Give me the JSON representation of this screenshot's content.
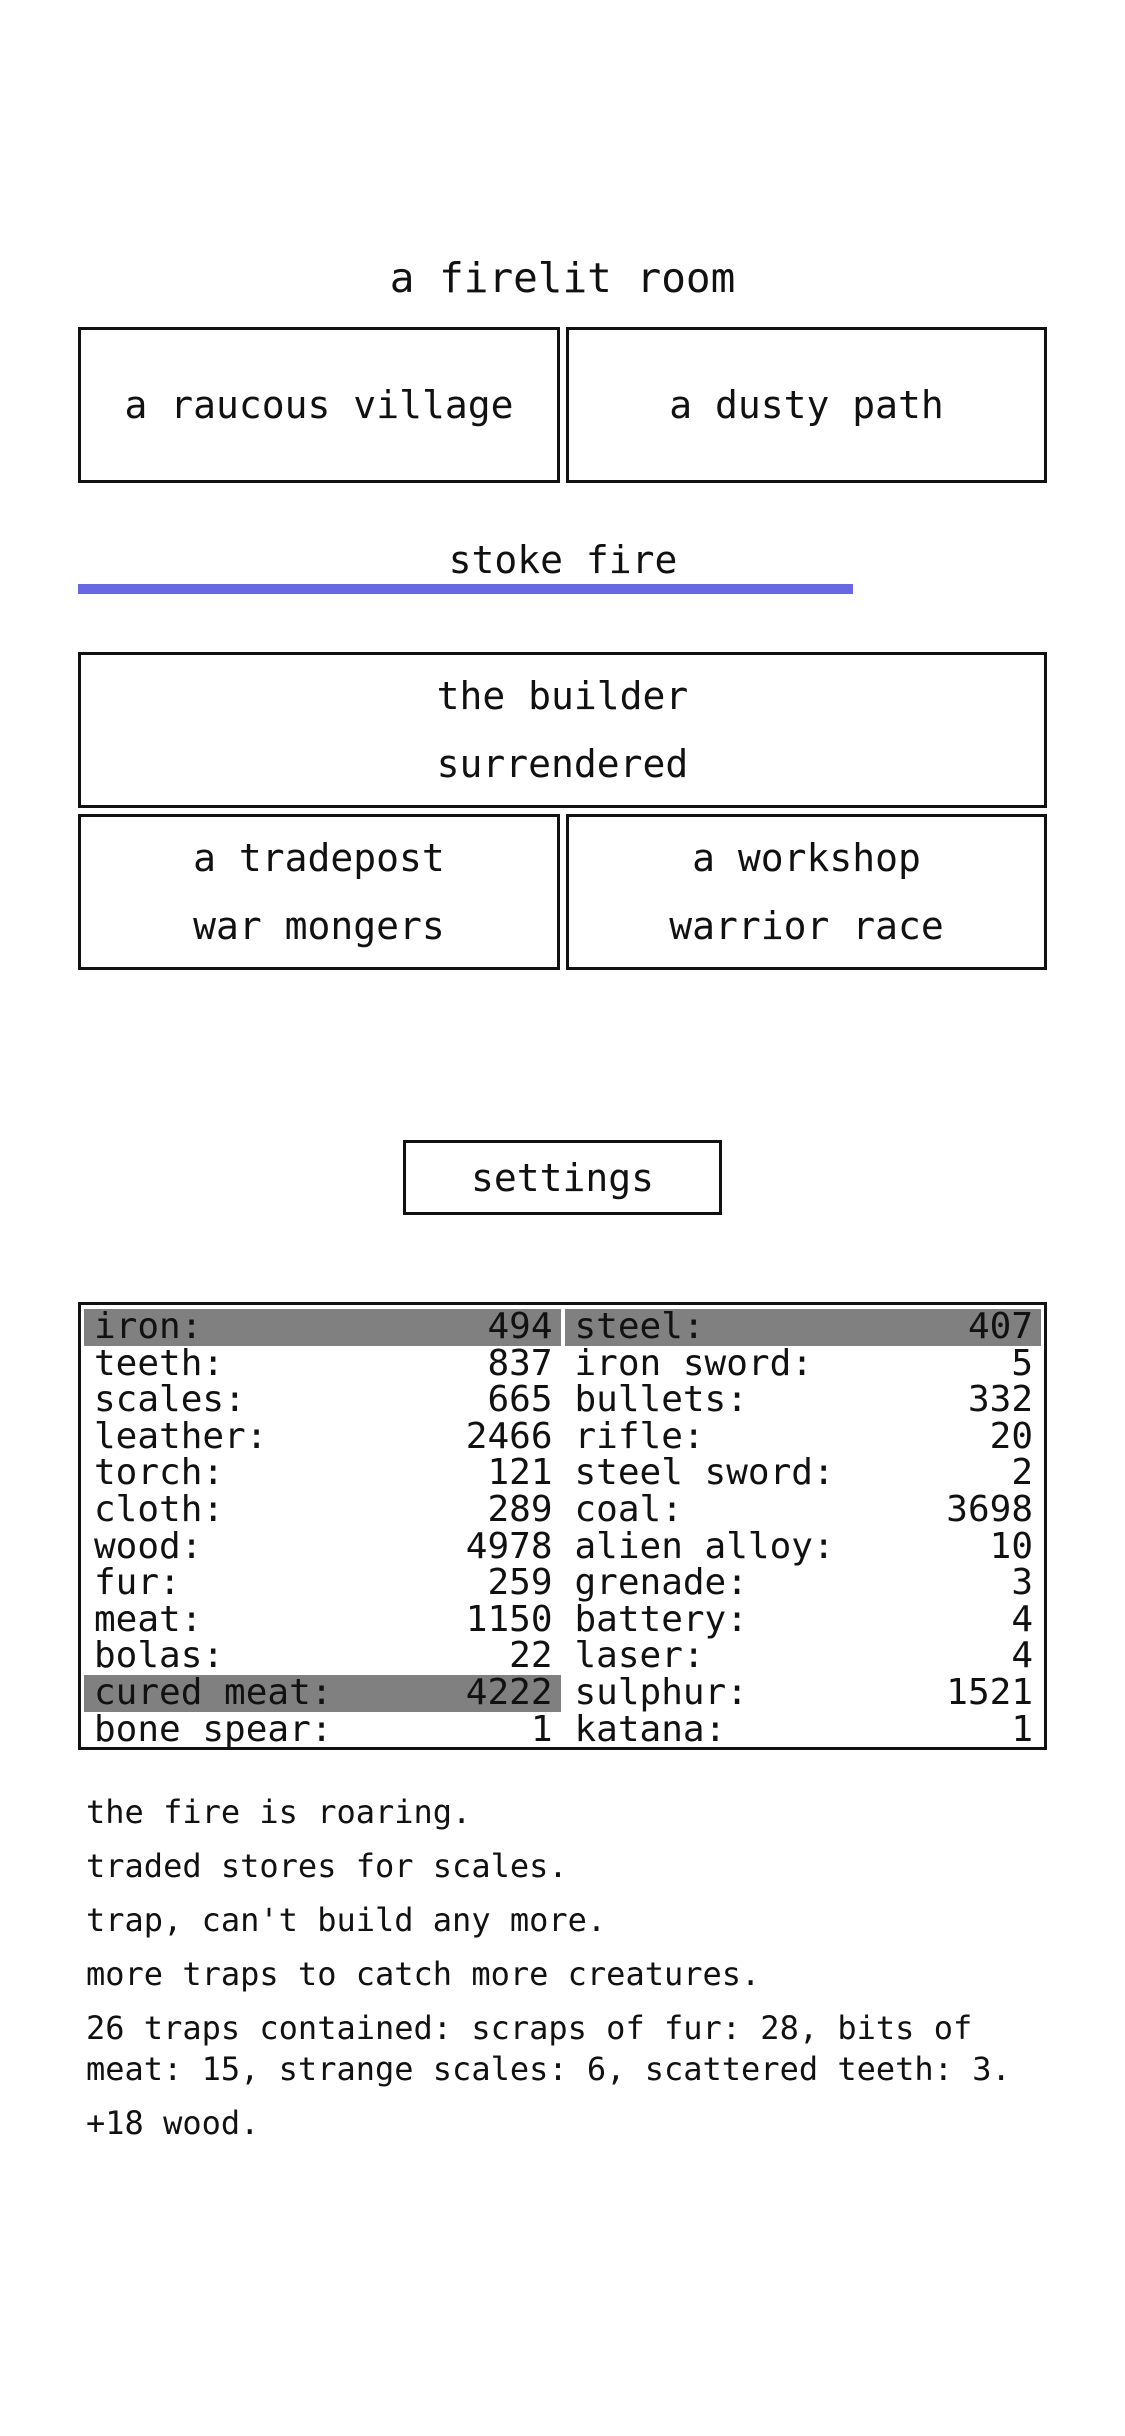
{
  "header": {
    "title": "a firelit room"
  },
  "nav": {
    "village": "a raucous village",
    "path": "a dusty path"
  },
  "actions": {
    "stoke": {
      "label": "stoke fire",
      "cooldown_fraction": 0.8
    }
  },
  "buildings": {
    "builder": [
      "the builder",
      "surrendered"
    ],
    "tradepost": [
      "a tradepost",
      "war mongers"
    ],
    "workshop": [
      "a workshop",
      "warrior race"
    ]
  },
  "settings_label": "settings",
  "stores": {
    "left": [
      {
        "name": "iron:",
        "value": "494",
        "highlight": true
      },
      {
        "name": "teeth:",
        "value": "837"
      },
      {
        "name": "scales:",
        "value": "665"
      },
      {
        "name": "leather:",
        "value": "2466"
      },
      {
        "name": "torch:",
        "value": "121"
      },
      {
        "name": "cloth:",
        "value": "289"
      },
      {
        "name": "wood:",
        "value": "4978"
      },
      {
        "name": "fur:",
        "value": "259"
      },
      {
        "name": "meat:",
        "value": "1150"
      },
      {
        "name": "bolas:",
        "value": "22"
      },
      {
        "name": "cured meat:",
        "value": "4222",
        "highlight": true
      },
      {
        "name": "bone spear:",
        "value": "1"
      }
    ],
    "right": [
      {
        "name": "steel:",
        "value": "407",
        "highlight": true
      },
      {
        "name": "iron sword:",
        "value": "5"
      },
      {
        "name": "bullets:",
        "value": "332"
      },
      {
        "name": "rifle:",
        "value": "20"
      },
      {
        "name": "steel sword:",
        "value": "2"
      },
      {
        "name": "coal:",
        "value": "3698"
      },
      {
        "name": "alien alloy:",
        "value": "10"
      },
      {
        "name": "grenade:",
        "value": "3"
      },
      {
        "name": "battery:",
        "value": "4"
      },
      {
        "name": "laser:",
        "value": "4"
      },
      {
        "name": "sulphur:",
        "value": "1521"
      },
      {
        "name": "katana:",
        "value": "1"
      }
    ]
  },
  "log": [
    "the fire is roaring.",
    "traded stores for scales.",
    "trap, can't build any more.",
    "more traps to catch more creatures.",
    "26 traps contained: scraps of fur: 28, bits of meat: 15, strange scales: 6, scattered teeth: 3.",
    "+18 wood."
  ],
  "colors": {
    "accent_bar": "#6868e2",
    "highlight_row": "#808080",
    "border": "#111111"
  }
}
